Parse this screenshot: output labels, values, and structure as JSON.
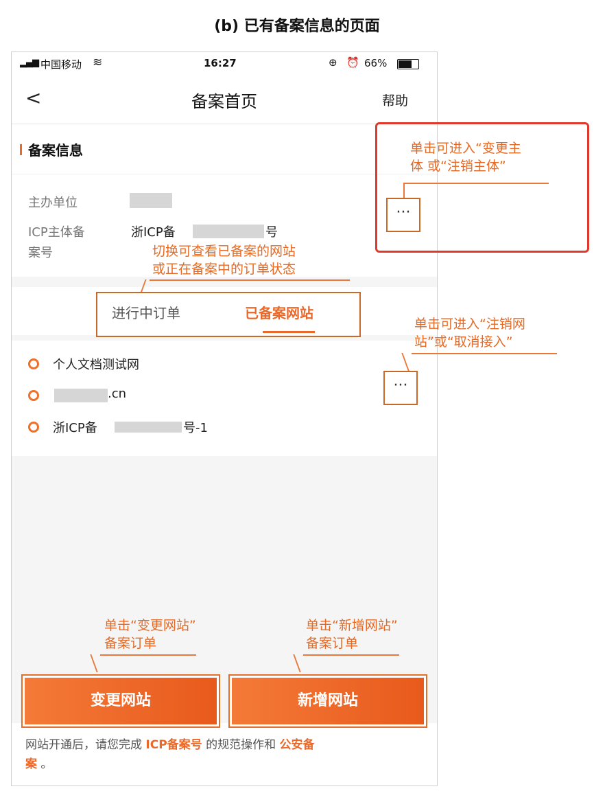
{
  "caption": "(b) 已有备案信息的页面",
  "status": {
    "carrier": "中国移动",
    "time": "16:27",
    "battery": "66%"
  },
  "nav": {
    "back": "<",
    "title": "备案首页",
    "help": "帮助"
  },
  "info": {
    "header": "备案信息",
    "sponsor_label": "主办单位",
    "icp_label_1": "ICP主体备",
    "icp_label_2": "案号",
    "icp_prefix": "浙ICP备",
    "icp_suffix": "号"
  },
  "tabs": {
    "ongoing": "进行中订单",
    "filed": "已备案网站"
  },
  "sites": {
    "item1": "个人文档测试网",
    "item2_suffix": ".cn",
    "item3_prefix": "浙ICP备",
    "item3_suffix": "号-1"
  },
  "buttons": {
    "change": "变更网站",
    "add": "新增网站"
  },
  "footer": {
    "t1": "网站开通后，请您完成 ",
    "link1": "ICP备案号",
    "t2": " 的规范操作和 ",
    "link2": "公安备",
    "link2b": "案",
    "t3": " 。"
  },
  "annotations": {
    "a1_line1": "单击可进入“变更主",
    "a1_line2": "体 或“注销主体”",
    "a2_line1": "切换可查看已备案的网站",
    "a2_line2": "或正在备案中的订单状态",
    "a3_line1": "单击可进入“注销网",
    "a3_line2": "站”或“取消接入”",
    "a4_line1": "单击“变更网站”",
    "a4_line2": "备案订单",
    "a5_line1": "单击“新增网站”",
    "a5_line2": "备案订单"
  },
  "colors": {
    "accent": "#e8692a",
    "highlight_red": "#e0392b"
  }
}
